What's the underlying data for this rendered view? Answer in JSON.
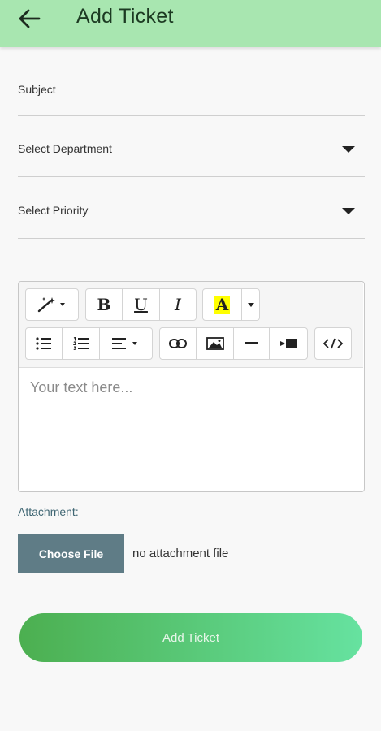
{
  "header": {
    "title": "Add Ticket",
    "back_icon": "arrow-left-icon"
  },
  "form": {
    "subject_label": "Subject",
    "department_label": "Select Department",
    "priority_label": "Select Priority"
  },
  "editor": {
    "placeholder": "Your text here...",
    "toolbar": {
      "bold": "B",
      "underline": "U",
      "italic": "I",
      "font_color": "A",
      "icons": [
        "magic-wand-icon",
        "bold-icon",
        "underline-icon",
        "italic-icon",
        "font-color-icon",
        "unordered-list-icon",
        "ordered-list-icon",
        "align-icon",
        "link-icon",
        "image-icon",
        "horizontal-rule-icon",
        "video-icon",
        "code-view-icon"
      ]
    }
  },
  "attachment": {
    "label": "Attachment:",
    "button_label": "Choose File",
    "status": "no attachment file"
  },
  "submit": {
    "label": "Add Ticket"
  },
  "colors": {
    "appbar": "#a8e6b0",
    "highlight": "#ffff00",
    "file_button": "#5f7c86",
    "gradient_start": "#4caf50",
    "gradient_end": "#66e2a0"
  }
}
